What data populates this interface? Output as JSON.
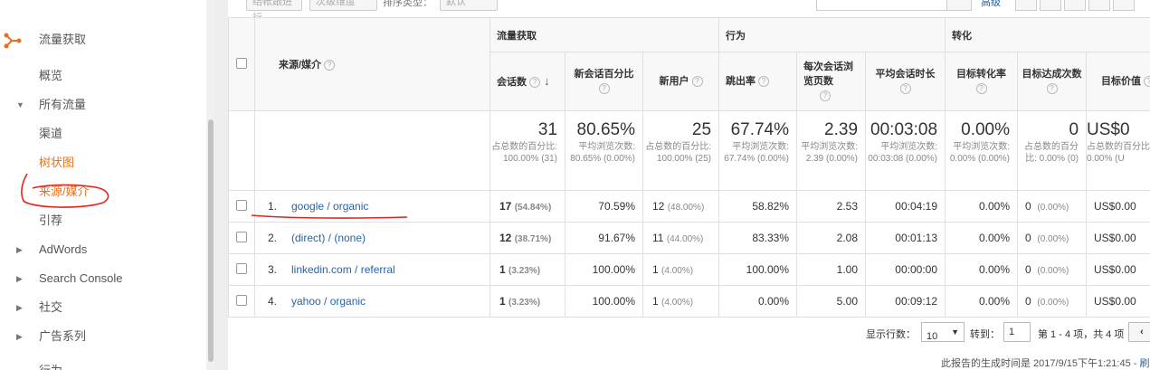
{
  "sidebar": {
    "section_title": "流量获取",
    "items": [
      {
        "label": "概览"
      },
      {
        "label": "所有流量"
      },
      {
        "label": "渠道"
      },
      {
        "label": "树状图"
      },
      {
        "label": "来源/媒介"
      },
      {
        "label": "引荐"
      },
      {
        "label": "AdWords"
      },
      {
        "label": "Search Console"
      },
      {
        "label": "社交"
      },
      {
        "label": "广告系列"
      },
      {
        "label": "行为"
      }
    ],
    "accent_color": "#e8711c"
  },
  "toolbar": {
    "btn1": "结帐跟进行",
    "btn2": "次级维度",
    "sort_label": "排序类型：",
    "sort_value": "默认",
    "advanced": "高级"
  },
  "table": {
    "groups": [
      "流量获取",
      "行为",
      "转化"
    ],
    "dimension_header": "来源/媒介",
    "columns": [
      "会话数",
      "新会话百分比",
      "新用户",
      "跳出率",
      "每次会话浏览页数",
      "平均会话时长",
      "目标转化率",
      "目标达成次数",
      "目标价值"
    ],
    "totals": {
      "sessions": "31",
      "sessions_sub": "占总数的百分比: 100.00% (31)",
      "new_pct": "80.65%",
      "new_pct_sub": "平均浏览次数: 80.65% (0.00%)",
      "new_users": "25",
      "new_users_sub": "占总数的百分比: 100.00% (25)",
      "bounce": "67.74%",
      "bounce_sub": "平均浏览次数: 67.74% (0.00%)",
      "pps": "2.39",
      "pps_sub": "平均浏览次数: 2.39 (0.00%)",
      "dur": "00:03:08",
      "dur_sub": "平均浏览次数: 00:03:08 (0.00%)",
      "conv": "0.00%",
      "conv_sub": "平均浏览次数: 0.00% (0.00%)",
      "goal": "0",
      "goal_sub": "占总数的百分比: 0.00% (0)",
      "value": "US$0",
      "value_sub": "占总数的百分比: 0.00% (U"
    },
    "rows": [
      {
        "idx": "1.",
        "source": "google / organic",
        "sessions": "17",
        "sessions_pct": "(54.84%)",
        "new_pct": "70.59%",
        "new_users": "12",
        "new_users_pct": "(48.00%)",
        "bounce": "58.82%",
        "pps": "2.53",
        "dur": "00:04:19",
        "conv": "0.00%",
        "goal": "0",
        "goal_pct": "(0.00%)",
        "value": "US$0.00"
      },
      {
        "idx": "2.",
        "source": "(direct) / (none)",
        "sessions": "12",
        "sessions_pct": "(38.71%)",
        "new_pct": "91.67%",
        "new_users": "11",
        "new_users_pct": "(44.00%)",
        "bounce": "83.33%",
        "pps": "2.08",
        "dur": "00:01:13",
        "conv": "0.00%",
        "goal": "0",
        "goal_pct": "(0.00%)",
        "value": "US$0.00"
      },
      {
        "idx": "3.",
        "source": "linkedin.com / referral",
        "sessions": "1",
        "sessions_pct": "(3.23%)",
        "new_pct": "100.00%",
        "new_users": "1",
        "new_users_pct": "(4.00%)",
        "bounce": "100.00%",
        "pps": "1.00",
        "dur": "00:00:00",
        "conv": "0.00%",
        "goal": "0",
        "goal_pct": "(0.00%)",
        "value": "US$0.00"
      },
      {
        "idx": "4.",
        "source": "yahoo / organic",
        "sessions": "1",
        "sessions_pct": "(3.23%)",
        "new_pct": "100.00%",
        "new_users": "1",
        "new_users_pct": "(4.00%)",
        "bounce": "0.00%",
        "pps": "5.00",
        "dur": "00:09:12",
        "conv": "0.00%",
        "goal": "0",
        "goal_pct": "(0.00%)",
        "value": "US$0.00"
      }
    ]
  },
  "pager": {
    "rows_label": "显示行数：",
    "rows_value": "10",
    "goto_label": "转到：",
    "goto_value": "1",
    "range": "第 1 - 4 项，共 4 项",
    "prev": "‹"
  },
  "footer": {
    "generated": "此报告的生成时间是 2017/9/15下午1:21:45 - ",
    "refresh": "刷"
  }
}
